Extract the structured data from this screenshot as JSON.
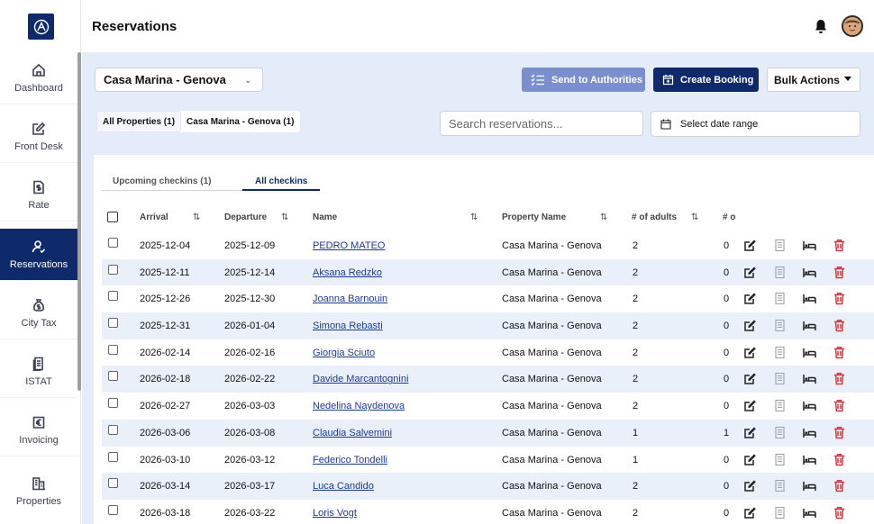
{
  "app": {
    "title": "Reservations"
  },
  "sidebar": {
    "items": [
      {
        "label": "Dashboard",
        "icon": "home-icon"
      },
      {
        "label": "Front Desk",
        "icon": "edit-icon"
      },
      {
        "label": "Rate",
        "icon": "dollar-doc-icon"
      },
      {
        "label": "Reservations",
        "icon": "user-check-icon",
        "active": true
      },
      {
        "label": "City Tax",
        "icon": "money-bag-icon"
      },
      {
        "label": "ISTAT",
        "icon": "document-icon"
      },
      {
        "label": "Invoicing",
        "icon": "euro-icon"
      },
      {
        "label": "Properties",
        "icon": "building-icon"
      }
    ]
  },
  "toolbar": {
    "property_select": "Casa Marina - Genova",
    "send_authorities": "Send to Authorities",
    "create_booking": "Create Booking",
    "bulk_actions": "Bulk Actions"
  },
  "filters": {
    "chip_all": "All Properties (1)",
    "chip_property": "Casa Marina - Genova (1)",
    "search_placeholder": "Search reservations...",
    "date_range": "Select date range"
  },
  "tabs": [
    {
      "label": "Upcoming checkins (1)"
    },
    {
      "label": "All checkins",
      "active": true
    }
  ],
  "table": {
    "columns": [
      "Arrival",
      "Departure",
      "Name",
      "Property Name",
      "# of adults",
      "# o"
    ],
    "rows": [
      {
        "arrival": "2025-12-04",
        "departure": "2025-12-09",
        "name": "PEDRO MATEO",
        "property": "Casa Marina - Genova",
        "adults": "2",
        "children": "0"
      },
      {
        "arrival": "2025-12-11",
        "departure": "2025-12-14",
        "name": "Aksana Redzko",
        "property": "Casa Marina - Genova",
        "adults": "2",
        "children": "0"
      },
      {
        "arrival": "2025-12-26",
        "departure": "2025-12-30",
        "name": "Joanna Barnouin",
        "property": "Casa Marina - Genova",
        "adults": "2",
        "children": "0"
      },
      {
        "arrival": "2025-12-31",
        "departure": "2026-01-04",
        "name": "Simona Rebasti",
        "property": "Casa Marina - Genova",
        "adults": "2",
        "children": "0"
      },
      {
        "arrival": "2026-02-14",
        "departure": "2026-02-16",
        "name": "Giorgia Sciuto",
        "property": "Casa Marina - Genova",
        "adults": "2",
        "children": "0"
      },
      {
        "arrival": "2026-02-18",
        "departure": "2026-02-22",
        "name": "Davide Marcantognini",
        "property": "Casa Marina - Genova",
        "adults": "2",
        "children": "0"
      },
      {
        "arrival": "2026-02-27",
        "departure": "2026-03-03",
        "name": "Nedelina Naydenova",
        "property": "Casa Marina - Genova",
        "adults": "2",
        "children": "0"
      },
      {
        "arrival": "2026-03-06",
        "departure": "2026-03-08",
        "name": "Claudia Salvemini",
        "property": "Casa Marina - Genova",
        "adults": "1",
        "children": "1"
      },
      {
        "arrival": "2026-03-10",
        "departure": "2026-03-12",
        "name": "Federico Tondelli",
        "property": "Casa Marina - Genova",
        "adults": "1",
        "children": "0"
      },
      {
        "arrival": "2026-03-14",
        "departure": "2026-03-17",
        "name": "Luca Candido",
        "property": "Casa Marina - Genova",
        "adults": "2",
        "children": "0"
      },
      {
        "arrival": "2026-03-18",
        "departure": "2026-03-22",
        "name": "Loris Vogt",
        "property": "Casa Marina - Genova",
        "adults": "2",
        "children": "0"
      }
    ]
  },
  "colors": {
    "brand": "#0e2a6b",
    "accent": "#7b8fce",
    "delete": "#d9363e",
    "row_alt": "#e9f0fa"
  }
}
